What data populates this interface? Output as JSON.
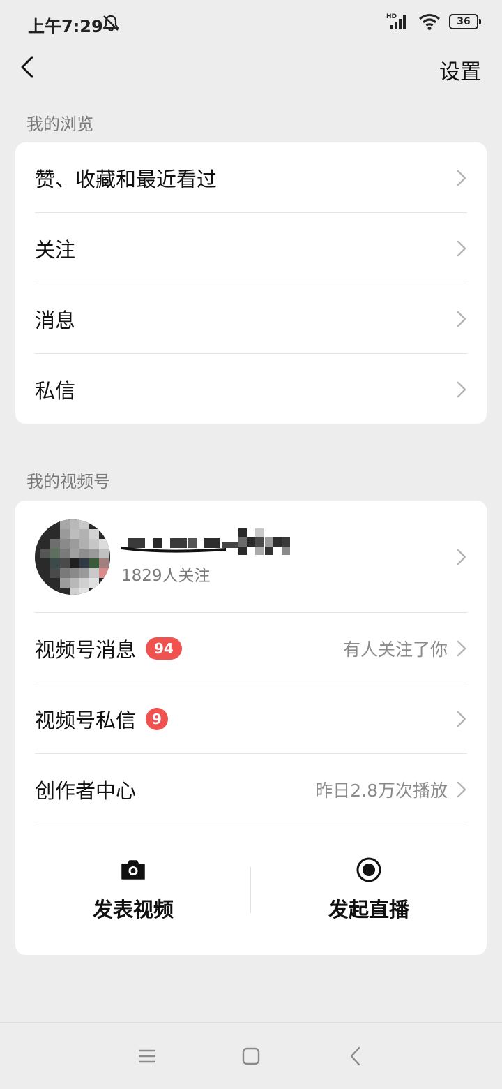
{
  "status_bar": {
    "time": "上午7:29",
    "network_label": "HD",
    "battery": "36"
  },
  "header": {
    "settings_label": "设置"
  },
  "browse_section": {
    "title": "我的浏览",
    "items": [
      {
        "label": "赞、收藏和最近看过"
      },
      {
        "label": "关注"
      },
      {
        "label": "消息"
      },
      {
        "label": "私信"
      }
    ]
  },
  "channels_section": {
    "title": "我的视频号",
    "profile": {
      "followers": "1829人关注"
    },
    "items": [
      {
        "label": "视频号消息",
        "badge": "94",
        "sub": "有人关注了你"
      },
      {
        "label": "视频号私信",
        "badge": "9",
        "sub": ""
      },
      {
        "label": "创作者中心",
        "badge": "",
        "sub": "昨日2.8万次播放"
      }
    ],
    "actions": [
      {
        "label": "发表视频",
        "icon": "camera-icon"
      },
      {
        "label": "发起直播",
        "icon": "live-record-icon"
      }
    ]
  },
  "colors": {
    "background": "#ededed",
    "card": "#ffffff",
    "badge": "#f0524f",
    "secondary_text": "#7a7a7a"
  }
}
